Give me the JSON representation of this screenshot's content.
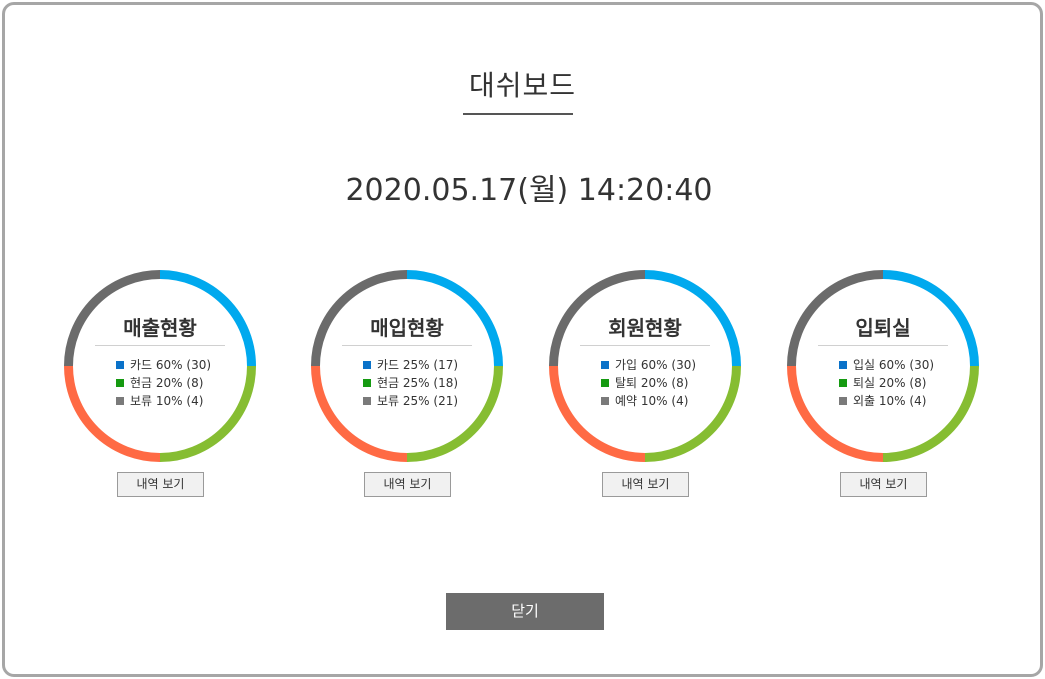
{
  "header": {
    "title": "대쉬보드",
    "datetime": "2020.05.17(월)  14:20:40"
  },
  "colors": {
    "blue": "#00a9ee",
    "green": "#86bd32",
    "orange": "#ff6a44",
    "gray": "#6b6b6b"
  },
  "cards": [
    {
      "title": "매출현황",
      "legend": [
        "카드 60% (30)",
        "현금 20% (8)",
        "보류 10% (4)"
      ],
      "button": "내역 보기"
    },
    {
      "title": "매입현황",
      "legend": [
        "카드 25% (17)",
        "현금 25% (18)",
        "보류 25% (21)"
      ],
      "button": "내역 보기"
    },
    {
      "title": "회원현황",
      "legend": [
        "가입 60% (30)",
        "탈퇴 20% (8)",
        "예약 10% (4)"
      ],
      "button": "내역 보기"
    },
    {
      "title": "입퇴실",
      "legend": [
        "입실 60% (30)",
        "퇴실 20% (8)",
        "외출 10% (4)"
      ],
      "button": "내역 보기"
    }
  ],
  "footer": {
    "close_label": "닫기"
  }
}
